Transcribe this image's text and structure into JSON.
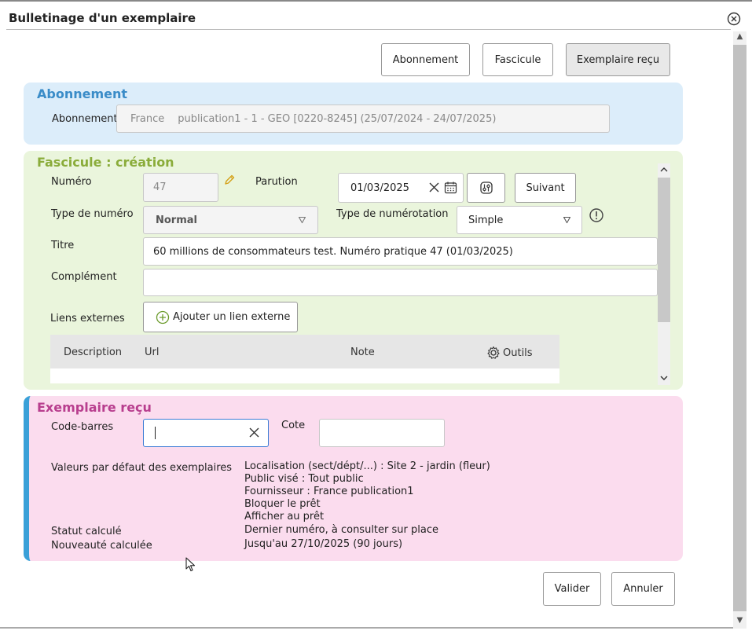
{
  "dialog": {
    "title": "Bulletinage d'un exemplaire"
  },
  "top_buttons": {
    "abonnement": "Abonnement",
    "fascicule": "Fascicule",
    "exemplaire": "Exemplaire reçu"
  },
  "abonnement_panel": {
    "title": "Abonnement",
    "label": "Abonnement",
    "value_prefix": "France",
    "value": "publication1 - 1 - GEO [0220-8245] (25/07/2024 - 24/07/2025)"
  },
  "fascicule_panel": {
    "title": "Fascicule : création",
    "numero_label": "Numéro",
    "numero_value": "47",
    "parution_label": "Parution",
    "parution_value": "01/03/2025",
    "suivant_label": "Suivant",
    "type_numero_label": "Type de numéro",
    "type_numero_value": "Normal",
    "type_numerotation_label": "Type de numérotation",
    "type_numerotation_value": "Simple",
    "titre_label": "Titre",
    "titre_value": "60 millions de consommateurs test. Numéro pratique 47 (01/03/2025)",
    "complement_label": "Complément",
    "complement_value": "",
    "liens_label": "Liens externes",
    "ajouter_label": "Ajouter un lien externe",
    "table": {
      "headers": [
        "Description",
        "Url",
        "Note"
      ],
      "tools_label": "Outils"
    }
  },
  "exemplaire_panel": {
    "title": "Exemplaire reçu",
    "codebarres_label": "Code-barres",
    "codebarres_value": "",
    "cote_label": "Cote",
    "cote_value": "",
    "defaults_label": "Valeurs par défaut des exemplaires",
    "defaults_lines": [
      "Localisation (sect/dépt/...) : Site 2 - jardin (fleur)",
      "Public visé : Tout public",
      "Fournisseur : France publication1",
      "Bloquer le prêt",
      "Afficher au prêt"
    ],
    "statut_label": "Statut calculé",
    "statut_value": "Dernier numéro, à consulter sur place",
    "nouveaute_label": "Nouveauté calculée",
    "nouveaute_value": "Jusqu'au 27/10/2025 (90 jours)"
  },
  "footer": {
    "valider": "Valider",
    "annuler": "Annuler"
  },
  "colors": {
    "abonnement_bg": "#dcedfa",
    "abonnement_title": "#3a8cc8",
    "fascicule_bg": "#eaf5dc",
    "fascicule_title": "#8aac3a",
    "exemplaire_bg": "#fbdcee",
    "exemplaire_title": "#b83e8e",
    "accent_bar": "#3aa0d8"
  }
}
